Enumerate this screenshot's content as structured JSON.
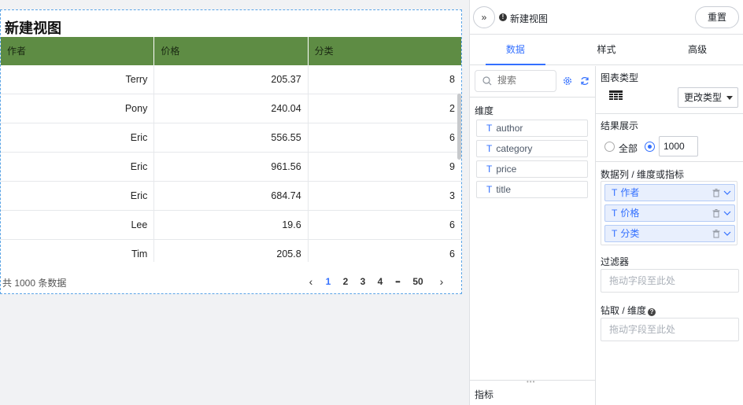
{
  "view": {
    "title": "新建视图"
  },
  "table": {
    "columns": [
      "作者",
      "价格",
      "分类"
    ],
    "rows": [
      [
        "Terry",
        "205.37",
        "8"
      ],
      [
        "Pony",
        "240.04",
        "2"
      ],
      [
        "Eric",
        "556.55",
        "6"
      ],
      [
        "Eric",
        "961.56",
        "9"
      ],
      [
        "Eric",
        "684.74",
        "3"
      ],
      [
        "Lee",
        "19.6",
        "6"
      ],
      [
        "Tim",
        "205.8",
        "6"
      ]
    ],
    "total_text": "共 1000 条数据",
    "pagination": {
      "prev": "‹",
      "pages": [
        "1",
        "2",
        "3",
        "4"
      ],
      "ellipsis": "•••",
      "last": "50",
      "next": "›",
      "current": "1"
    }
  },
  "panel": {
    "collapse_glyph": "»",
    "view_name": "新建视图",
    "reset_label": "重置",
    "tabs": [
      {
        "label": "数据",
        "active": true
      },
      {
        "label": "样式",
        "active": false
      },
      {
        "label": "高级",
        "active": false
      }
    ],
    "search_placeholder": "搜索",
    "dimension_label": "维度",
    "dimension_fields": [
      "author",
      "category",
      "price",
      "title"
    ],
    "field_type_glyph": "T",
    "metric_label": "指标",
    "chart_type_label": "图表类型",
    "change_type_label": "更改类型",
    "result_label": "结果展示",
    "result_options": [
      {
        "label": "全部",
        "selected": false
      },
      {
        "label": "",
        "selected": true
      }
    ],
    "result_limit": "1000",
    "columns_label": "数据列 / 维度或指标",
    "column_items": [
      "作者",
      "价格",
      "分类"
    ],
    "filter_label": "过滤器",
    "filter_placeholder": "拖动字段至此处",
    "drill_label": "钻取 / 维度",
    "drill_placeholder": "拖动字段至此处"
  },
  "colors": {
    "header_green": "#5e8c44",
    "accent_blue": "#3370ff",
    "chip_bg": "#e8effd"
  }
}
